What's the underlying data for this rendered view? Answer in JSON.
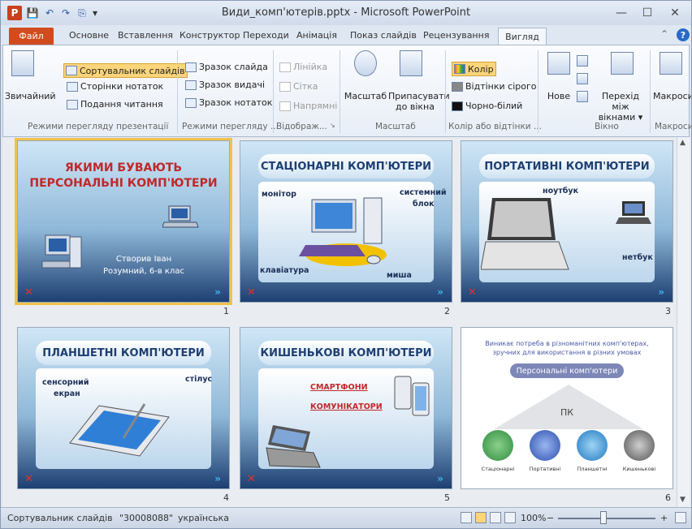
{
  "window": {
    "title": "Види_комп'ютерів.pptx - Microsoft PowerPoint",
    "app_badge": "P"
  },
  "quick_access": {
    "save": "💾",
    "undo": "↶",
    "redo": "↷",
    "custom": "⎘",
    "more": "▾"
  },
  "window_buttons": {
    "minimize": "—",
    "maximize": "☐",
    "close": "✕"
  },
  "tabs": {
    "file": "Файл",
    "items": [
      "Основне",
      "Вставлення",
      "Конструктор",
      "Переходи",
      "Анімація",
      "Показ слайдів",
      "Рецензування"
    ],
    "active": "Вигляд"
  },
  "help": {
    "collapse": "⌃",
    "icon": "?"
  },
  "ribbon": {
    "views": {
      "normal": "Звичайний",
      "sorter": "Сортувальник слайдів",
      "notes_page": "Сторінки нотаток",
      "reading": "Подання читання",
      "group": "Режими перегляду презентації"
    },
    "masters": {
      "slide": "Зразок слайда",
      "handout": "Зразок видачі",
      "notes": "Зразок нотаток",
      "group": "Режими перегляду ..."
    },
    "show": {
      "ruler": "Лінійка",
      "grid": "Сітка",
      "guides": "Напрямні",
      "group": "Відображ...",
      "launcher": "↘"
    },
    "zoom": {
      "zoom": "Масштаб",
      "fit_line1": "Припасувати",
      "fit_line2": "до вікна",
      "group": "Масштаб"
    },
    "color": {
      "color": "Колір",
      "gray": "Відтінки сірого",
      "bw": "Чорно-білий",
      "group": "Колір або відтінки ..."
    },
    "window": {
      "new": "Нове",
      "switch_line1": "Перехід між",
      "switch_line2": "вікнами ▾",
      "group": "Вікно"
    },
    "macros": {
      "macros": "Макроси",
      "group": "Макроси"
    }
  },
  "slides": [
    {
      "num": "1",
      "title": "ЯКИМИ БУВАЮТЬ ПЕРСОНАЛЬНІ КОМП'ЮТЕРИ",
      "author_line1": "Створив Іван",
      "author_line2": "Розумний, 6-в клас"
    },
    {
      "num": "2",
      "title": "СТАЦІОНАРНІ КОМП'ЮТЕРИ",
      "labels": [
        "монітор",
        "системний",
        "блок",
        "клавіатура",
        "миша"
      ]
    },
    {
      "num": "3",
      "title": "ПОРТАТИВНІ КОМП'ЮТЕРИ",
      "labels": [
        "ноутбук",
        "нетбук"
      ]
    },
    {
      "num": "4",
      "title": "ПЛАНШЕТНІ КОМП'ЮТЕРИ",
      "labels": [
        "сенсорний",
        "екран",
        "стілус"
      ]
    },
    {
      "num": "5",
      "title": "КИШЕНЬКОВІ КОМП'ЮТЕРИ",
      "labels": [
        "СМАРТФОНИ",
        "КОМУНІКАТОРИ"
      ]
    },
    {
      "num": "6",
      "text_line1": "Виникає потреба в різноманітних комп'ютерах,",
      "text_line2": "зручних для використання в різних умовах",
      "pill": "Персональні комп'ютери",
      "pk": "ПК",
      "circles": [
        "Стаціонарні",
        "Портативні",
        "Планшетні",
        "Кишенькові"
      ]
    }
  ],
  "status": {
    "view": "Сортувальник слайдів",
    "theme": "\"30008088\"",
    "lang": "українська",
    "zoom": "100%",
    "minus": "−",
    "plus": "+"
  },
  "colors": {
    "accent_file": "#d14b1f",
    "highlight": "#fbd57a",
    "slide_dark": "#1b3a6c",
    "title_text": "#1d3f72",
    "red_title": "#c0282a"
  }
}
